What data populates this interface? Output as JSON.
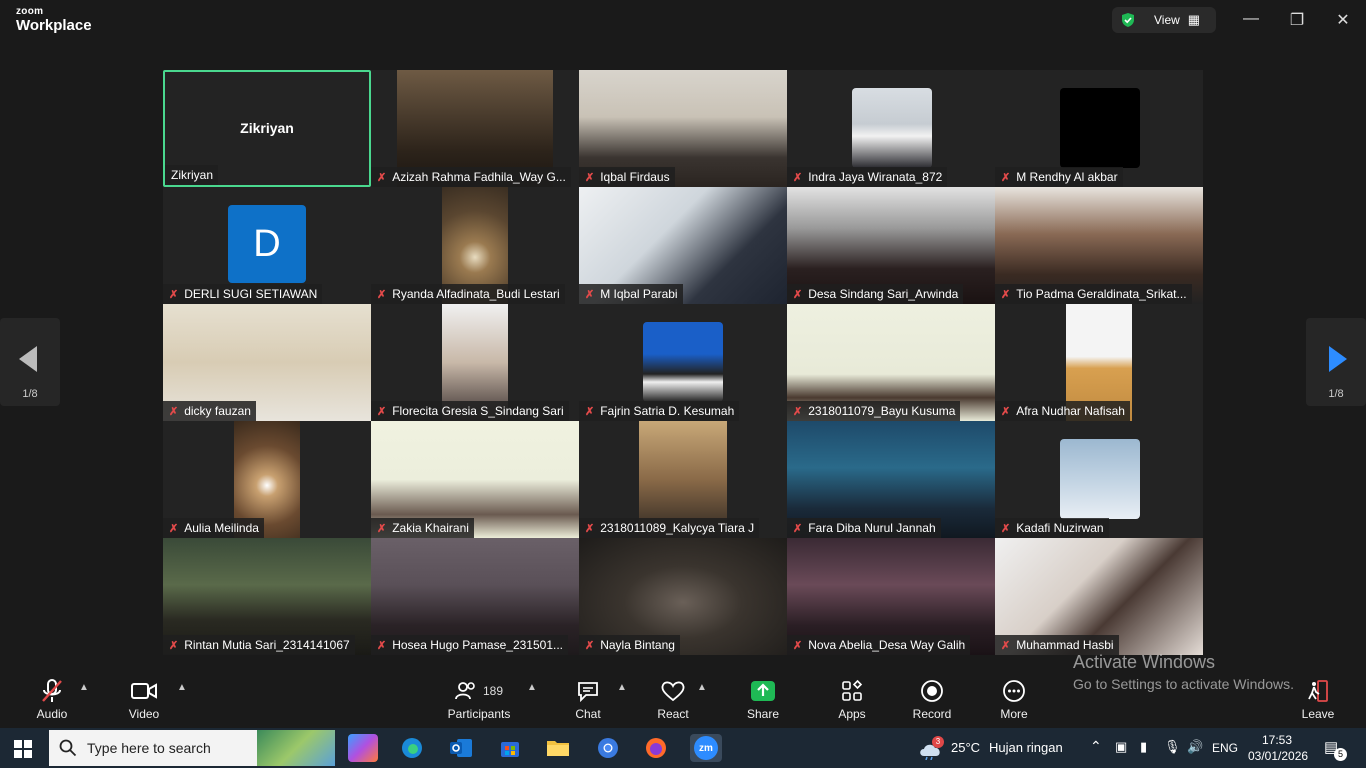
{
  "app": {
    "brand_top": "zoom",
    "brand_bottom": "Workplace"
  },
  "header": {
    "view_label": "View"
  },
  "colors": {
    "active_speaker": "#4ad88f",
    "mic_muted": "#e24a4a",
    "share_green": "#1fb955",
    "avatar_blue": "#0e71c8"
  },
  "gallery": {
    "participants": [
      {
        "name": "Zikriyan",
        "big_name": "Zikriyan",
        "active": true,
        "muted": false
      },
      {
        "name": "Azizah Rahma Fadhila_Way G...",
        "muted": true
      },
      {
        "name": "Iqbal Firdaus",
        "muted": true
      },
      {
        "name": "Indra Jaya Wiranata_872",
        "muted": true
      },
      {
        "name": "M Rendhy Al akbar",
        "muted": true
      },
      {
        "name": "DERLI SUGI SETIAWAN",
        "avatar_letter": "D",
        "muted": true
      },
      {
        "name": "Ryanda Alfadinata_Budi Lestari",
        "muted": true
      },
      {
        "name": "M Iqbal Parabi",
        "muted": true
      },
      {
        "name": "Desa Sindang Sari_Arwinda",
        "muted": true
      },
      {
        "name": "Tio Padma Geraldinata_Srikat...",
        "muted": true
      },
      {
        "name": "dicky fauzan",
        "muted": true
      },
      {
        "name": "Florecita Gresia S_Sindang Sari",
        "muted": true
      },
      {
        "name": "Fajrin Satria D. Kesumah",
        "muted": true
      },
      {
        "name": "2318011079_Bayu Kusuma",
        "muted": true
      },
      {
        "name": "Afra Nudhar Nafisah",
        "muted": true
      },
      {
        "name": "Aulia Meilinda",
        "muted": true
      },
      {
        "name": "Zakia Khairani",
        "muted": true
      },
      {
        "name": "2318011089_Kalycya Tiara J",
        "muted": true
      },
      {
        "name": "Fara Diba Nurul Jannah",
        "muted": true
      },
      {
        "name": "Kadafi Nuzirwan",
        "muted": true
      },
      {
        "name": "Rintan Mutia Sari_2314141067",
        "muted": true
      },
      {
        "name": "Hosea Hugo Pamase_231501...",
        "muted": true
      },
      {
        "name": "Nayla Bintang",
        "muted": true
      },
      {
        "name": "Nova Abelia_Desa Way Galih",
        "muted": true
      },
      {
        "name": "Muhammad Hasbi",
        "muted": true
      }
    ],
    "prev_page": "1/8",
    "next_page": "1/8"
  },
  "toolbar": {
    "audio": "Audio",
    "video": "Video",
    "participants": "Participants",
    "participants_count": "189",
    "chat": "Chat",
    "react": "React",
    "share": "Share",
    "apps": "Apps",
    "record": "Record",
    "more": "More",
    "leave": "Leave"
  },
  "watermark": {
    "line1": "Activate Windows",
    "line2": "Go to Settings to activate Windows."
  },
  "taskbar": {
    "search_placeholder": "Type here to search",
    "zoom_label": "zm",
    "weather_badge": "3",
    "temperature": "25°C",
    "weather": "Hujan ringan",
    "language": "ENG",
    "time": "17:53",
    "date": "03/01/2026",
    "notifications": "5"
  }
}
